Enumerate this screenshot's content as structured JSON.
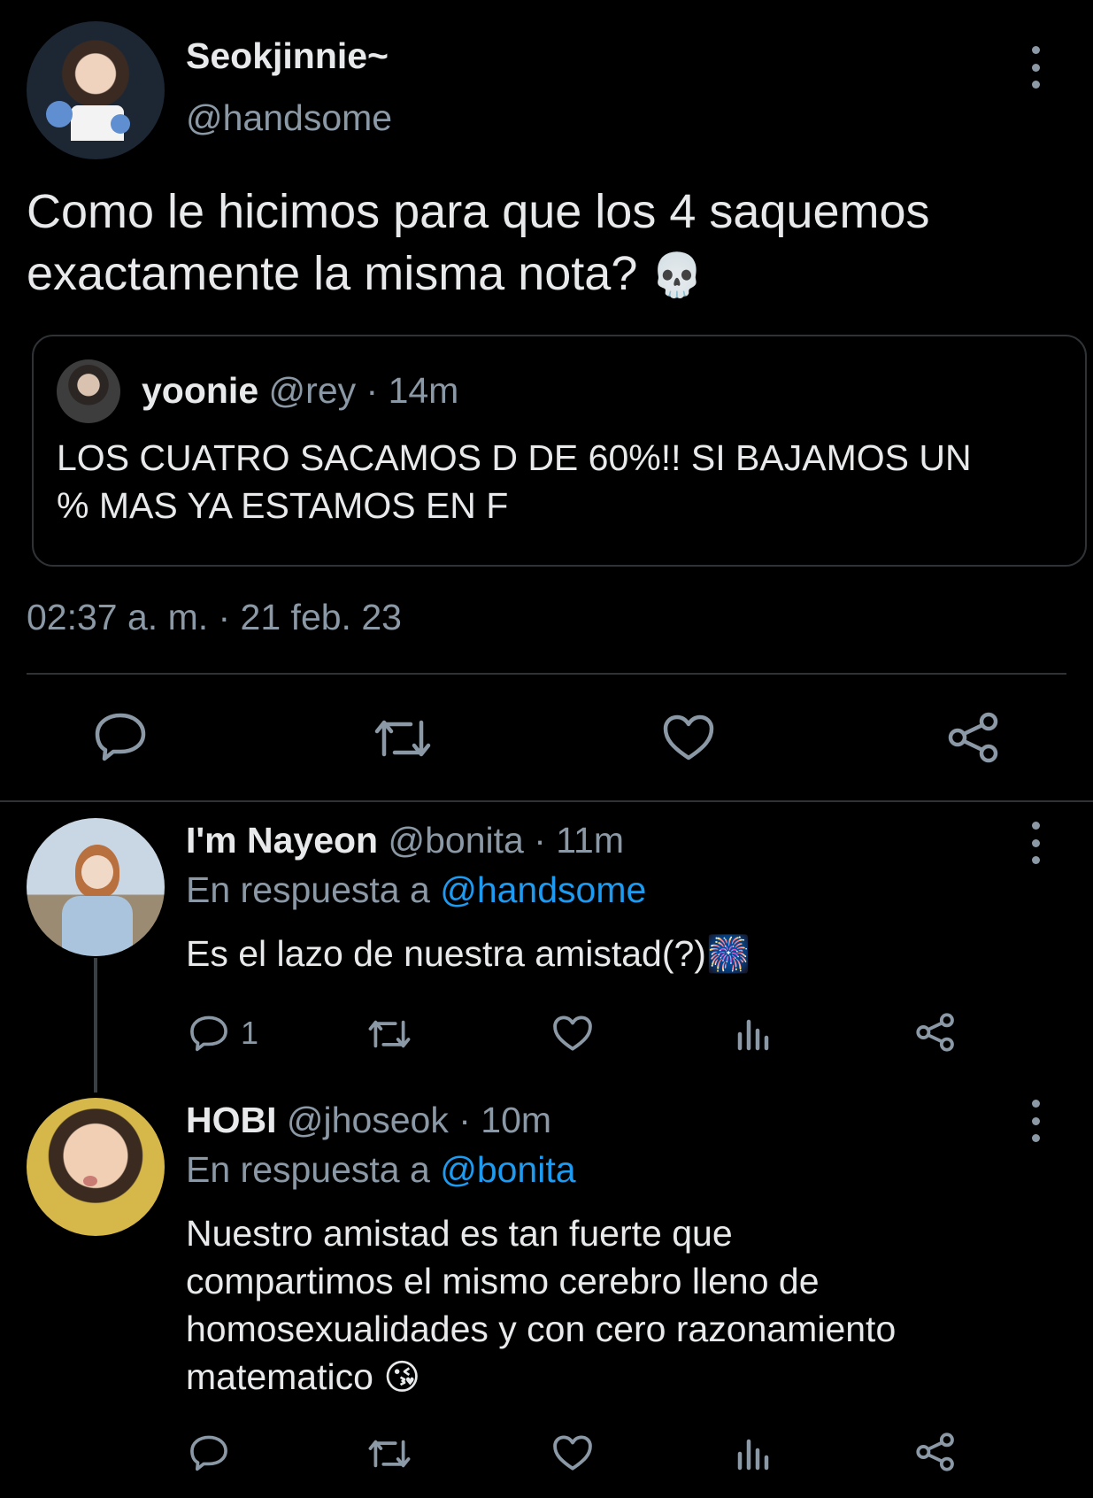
{
  "main_tweet": {
    "display_name": "Seokjinnie~",
    "handle": "@handsome",
    "text_line1": "Como le hicimos para que los 4 saquemos",
    "text_line2": "exactamente la misma nota?",
    "emoji": "💀",
    "timestamp": "02:37 a. m. · 21 feb. 23"
  },
  "quoted_tweet": {
    "display_name": "yoonie",
    "handle": "@rey",
    "time": "· 14m",
    "text_line1": "LOS CUATRO SACAMOS D DE 60%!! SI BAJAMOS UN",
    "text_line2": "% MAS YA ESTAMOS EN F"
  },
  "reply1": {
    "display_name": "I'm Nayeon",
    "handle": "@bonita",
    "time": "· 11m",
    "reply_prefix": "En respuesta a",
    "reply_to": "@handsome",
    "text": "Es el lazo de nuestra amistad(?)",
    "emoji": "🎆",
    "reply_count": "1"
  },
  "reply2": {
    "display_name": "HOBI",
    "handle": "@jhoseok",
    "time": "· 10m",
    "reply_prefix": "En respuesta a",
    "reply_to": "@bonita",
    "text_line1": "Nuestro amistad es tan fuerte que",
    "text_line2": "compartimos el mismo cerebro lleno de",
    "text_line3": "homosexualidades y con cero razonamiento",
    "text_line4": "matematico",
    "emoji": "😘"
  },
  "icons": {
    "reply": "speech-bubble-icon",
    "retweet": "retweet-icon",
    "like": "heart-icon",
    "share": "share-icon",
    "analytics": "bar-chart-icon",
    "more": "vertical-dots-icon"
  },
  "colors": {
    "background": "#000000",
    "text": "#e7e9ea",
    "muted": "#8b98a5",
    "link": "#1d9bf0",
    "divider": "#2f3336"
  }
}
